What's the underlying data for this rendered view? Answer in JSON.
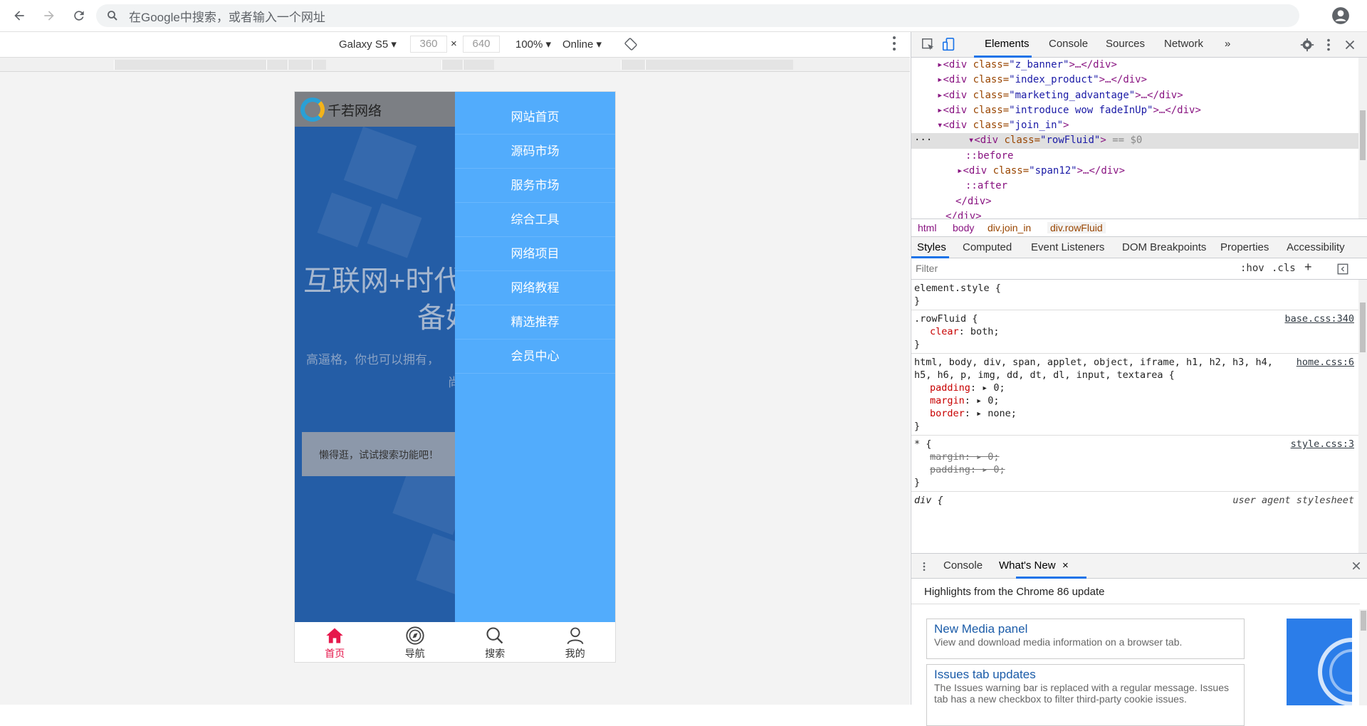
{
  "browser": {
    "omnibox_placeholder": "在Google中搜索，或者输入一个网址"
  },
  "device_toolbar": {
    "device": "Galaxy S5",
    "width": "360",
    "times": "×",
    "height": "640",
    "zoom": "100%",
    "network": "Online"
  },
  "page": {
    "logo_text": "千若网络",
    "headline_1": "互联网+时代",
    "headline_2": "备好",
    "subline": "高逼格，你也可以拥有，",
    "subline_2": "尚",
    "search_hint": "懒得逛，试试搜索功能吧！",
    "menu": [
      "网站首页",
      "源码市场",
      "服务市场",
      "综合工具",
      "网络项目",
      "网络教程",
      "精选推荐",
      "会员中心"
    ],
    "tabbar": [
      {
        "label": "首页",
        "icon": "home-icon",
        "active": true
      },
      {
        "label": "导航",
        "icon": "compass-icon",
        "active": false
      },
      {
        "label": "搜索",
        "icon": "search-icon",
        "active": false
      },
      {
        "label": "我的",
        "icon": "user-icon",
        "active": false
      }
    ],
    "active_color": "#e6184c",
    "menu_bg": "#52acfc"
  },
  "devtools": {
    "tabs": [
      "Elements",
      "Console",
      "Sources",
      "Network"
    ],
    "more_tabs": "»",
    "dom": {
      "l1_tag": "<div ",
      "l1_attr": "class=",
      "l1_val": "\"z_banner\"",
      "l1_end": ">…</div>",
      "l2_tag": "<div ",
      "l2_attr": "class=",
      "l2_val": "\"index_product\"",
      "l2_end": ">…</div>",
      "l3_tag": "<div ",
      "l3_attr": "class=",
      "l3_val": "\"marketing_advantage\"",
      "l3_end": ">…</div>",
      "l4_tag": "<div ",
      "l4_attr": "class=",
      "l4_val": "\"introduce wow fadeInUp\"",
      "l4_end": ">…</div>",
      "l5_tag": "<div ",
      "l5_attr": "class=",
      "l5_val": "\"join_in\"",
      "l5_end": ">",
      "l6_tag": "<div ",
      "l6_attr": "class=",
      "l6_val": "\"rowFluid\"",
      "l6_end": ">",
      "l6_eq": " == $0",
      "l7": "::before",
      "l8_tag": "<div ",
      "l8_attr": "class=",
      "l8_val": "\"span12\"",
      "l8_end": ">…</div>",
      "l9": "::after",
      "l10": "</div>",
      "l11": "</div>"
    },
    "breadcrumbs": [
      "html",
      "body",
      "div.join_in",
      "div.rowFluid"
    ],
    "sub_tabs": [
      "Styles",
      "Computed",
      "Event Listeners",
      "DOM Breakpoints",
      "Properties",
      "Accessibility"
    ],
    "filter_placeholder": "Filter",
    "hov": ":hov",
    "cls": ".cls",
    "plus": "+",
    "styles": {
      "r1_sel": "element.style {",
      "r1_close": "}",
      "r2_sel": ".rowFluid {",
      "r2_src": "base.css:340",
      "r2_p1n": "clear",
      "r2_p1v": ": both;",
      "r2_close": "}",
      "r3_sel1": "html, body, div, span, applet, object, iframe, h1, h2, h3, h4,",
      "r3_sel2": "h5, h6, p, img, dd, dt, dl, input, textarea {",
      "r3_src": "home.css:6",
      "r3_p1n": "padding",
      "r3_p1v": ": ▸ 0;",
      "r3_p2n": "margin",
      "r3_p2v": ": ▸ 0;",
      "r3_p3n": "border",
      "r3_p3v": ": ▸ none;",
      "r3_close": "}",
      "r4_sel": "* {",
      "r4_src": "style.css:3",
      "r4_p1": "margin: ▸ 0;",
      "r4_p2": "padding: ▸ 0;",
      "r4_close": "}",
      "r5_sel": "div {",
      "r5_src": "user agent stylesheet"
    },
    "drawer": {
      "tab_console": "Console",
      "tab_whatsnew": "What's New",
      "close_x": "×",
      "highlights": "Highlights from the Chrome 86 update",
      "card1_title": "New Media panel",
      "card1_desc": "View and download media information on a browser tab.",
      "card2_title": "Issues tab updates",
      "card2_desc": "The Issues warning bar is replaced with a regular message. Issues tab has a new checkbox to filter third-party cookie issues."
    }
  }
}
